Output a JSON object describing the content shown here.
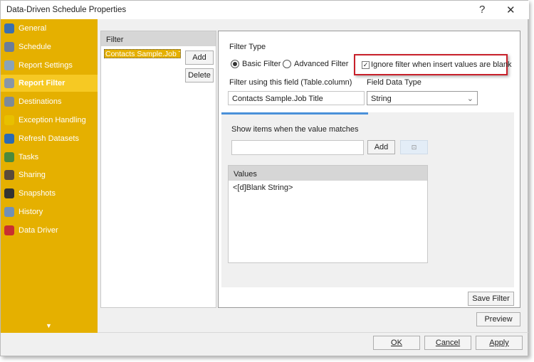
{
  "window": {
    "title": "Data-Driven Schedule Properties",
    "help": "?",
    "close": "✕"
  },
  "sidebar": {
    "items": [
      {
        "label": "General",
        "icon": "info-icon",
        "color": "#3a6fb0"
      },
      {
        "label": "Schedule",
        "icon": "clock-icon",
        "color": "#6b7d99"
      },
      {
        "label": "Report Settings",
        "icon": "report-icon",
        "color": "#8aa3b8"
      },
      {
        "label": "Report Filter",
        "icon": "database-filter-icon",
        "color": "#8896a8"
      },
      {
        "label": "Destinations",
        "icon": "destinations-icon",
        "color": "#7d8a99"
      },
      {
        "label": "Exception Handling",
        "icon": "warning-icon",
        "color": "#e8c000"
      },
      {
        "label": "Refresh Datasets",
        "icon": "refresh-icon",
        "color": "#2a6ab5"
      },
      {
        "label": "Tasks",
        "icon": "tasks-icon",
        "color": "#4b8a3c"
      },
      {
        "label": "Sharing",
        "icon": "sharing-icon",
        "color": "#5a4a3a"
      },
      {
        "label": "Snapshots",
        "icon": "camera-icon",
        "color": "#333333"
      },
      {
        "label": "History",
        "icon": "history-icon",
        "color": "#7090b8"
      },
      {
        "label": "Data Driver",
        "icon": "data-driver-icon",
        "color": "#c83030"
      }
    ],
    "selected": "Report Filter",
    "scroll": "▼"
  },
  "filter_list": {
    "header": "Filter",
    "items": [
      "Contacts Sample.Job Ti..."
    ],
    "add": "Add",
    "delete": "Delete"
  },
  "filter": {
    "type_label": "Filter Type",
    "basic": "Basic Filter",
    "advanced": "Advanced Filter",
    "selected_type": "Basic Filter",
    "ignore_blank": "Ignore filter when insert values are blank",
    "ignore_checked": true,
    "field_label": "Filter using this field (Table.column)",
    "field_value": "Contacts Sample.Job Title",
    "datatype_label": "Field Data Type",
    "datatype_value": "String",
    "match_label": "Show items when the value matches",
    "match_value": "",
    "add": "Add",
    "values_header": "Values",
    "values": [
      "<[d]Blank String>"
    ],
    "save": "Save Filter"
  },
  "footer": {
    "preview": "Preview",
    "ok": "OK",
    "cancel": "Cancel",
    "apply": "Apply"
  }
}
